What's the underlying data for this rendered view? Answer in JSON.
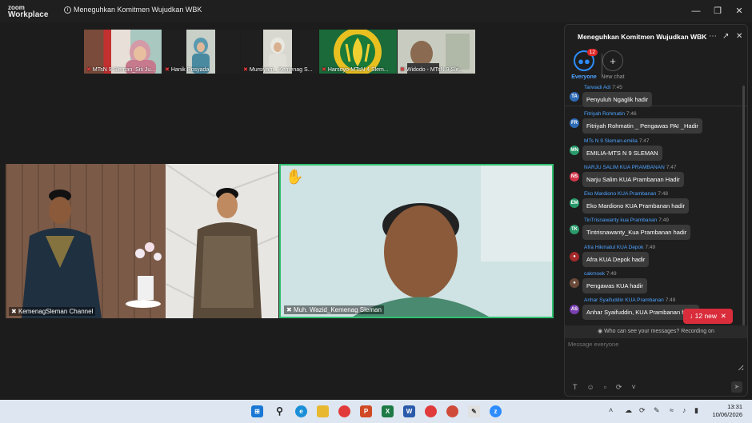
{
  "titlebar": {
    "logo_line1": "zoom",
    "logo_line2": "Workplace",
    "meeting_title": "Meneguhkan Komitmen Wujudkan WBK"
  },
  "thumbnails": [
    {
      "name": "MTsN 9 Sleman_Siti Ju..."
    },
    {
      "name": "Hanik Rosyada"
    },
    {
      "name": "Mursiyam_ Kemenag S..."
    },
    {
      "name": "Harsoyo-MTsN 4 Slem..."
    },
    {
      "name": "Widodo - MTsN 9 Sle..."
    }
  ],
  "videos": {
    "left_label": "KemenagSleman Channel",
    "right_label": "Muh. Wazid_Kemenag Sleman"
  },
  "chat": {
    "title": "Meneguhkan Komitmen Wujudkan WBK",
    "tab_everyone": "Everyone",
    "tab_everyone_badge": "12",
    "tab_new_chat": "New chat",
    "messages": [
      {
        "initials": "TA",
        "color": "#2d6bb5",
        "sender": "Tarwadi Adi",
        "time": "7:45",
        "text": "Penyuluh Ngaglik hadir"
      },
      {
        "initials": "FR",
        "color": "#2d6bb5",
        "sender": "Fitriyah Rohmatin",
        "time": "7:46",
        "text": "Fitriyah Rohmatin _ Pengawas PAI _Hadir"
      },
      {
        "initials": "MN",
        "color": "#2a9a6a",
        "sender": "MTs N 9 Sleman-emilia",
        "time": "7:47",
        "text": "EMILIA-MTS N 9 SLEMAN"
      },
      {
        "initials": "NS",
        "color": "#d2344a",
        "sender": "NARJU SALIM KUA PRAMBANAN",
        "time": "7:47",
        "text": "Narju Salim KUA Prambanan Hadir"
      },
      {
        "initials": "EM",
        "color": "#2a9a6a",
        "sender": "Eko Mardiono KUA Prambanan",
        "time": "7:48",
        "text": "Eko Mardiono KUA Prambanan hadir"
      },
      {
        "initials": "TK",
        "color": "#2a9a6a",
        "sender": "TinTrisnawanty kua Prambanan",
        "time": "7:49",
        "text": "Tintrisnawanty_Kua Prambanan hadir"
      },
      {
        "initials": "",
        "color": "#a32a2a",
        "sender": "Afra Hikmatul KUA Depok",
        "time": "7:49",
        "text": "Afra KUA Depok hadir"
      },
      {
        "initials": "",
        "color": "#6b4a3a",
        "sender": "cakmoek",
        "time": "7:49",
        "text": "Pengawas KUA hadir"
      },
      {
        "initials": "AS",
        "color": "#7a3fb0",
        "sender": "Anhar Syaifuddin KUA Prambanan",
        "time": "7:49",
        "text": "Anhar Syaifuddin, KUA Prambanan hadir"
      }
    ],
    "new_messages": "12 new",
    "privacy_note": "Who can see your messages? Recording on",
    "input_placeholder": "Message everyone"
  },
  "taskbar": {
    "time": "13:31",
    "date": "10/06/2026"
  }
}
